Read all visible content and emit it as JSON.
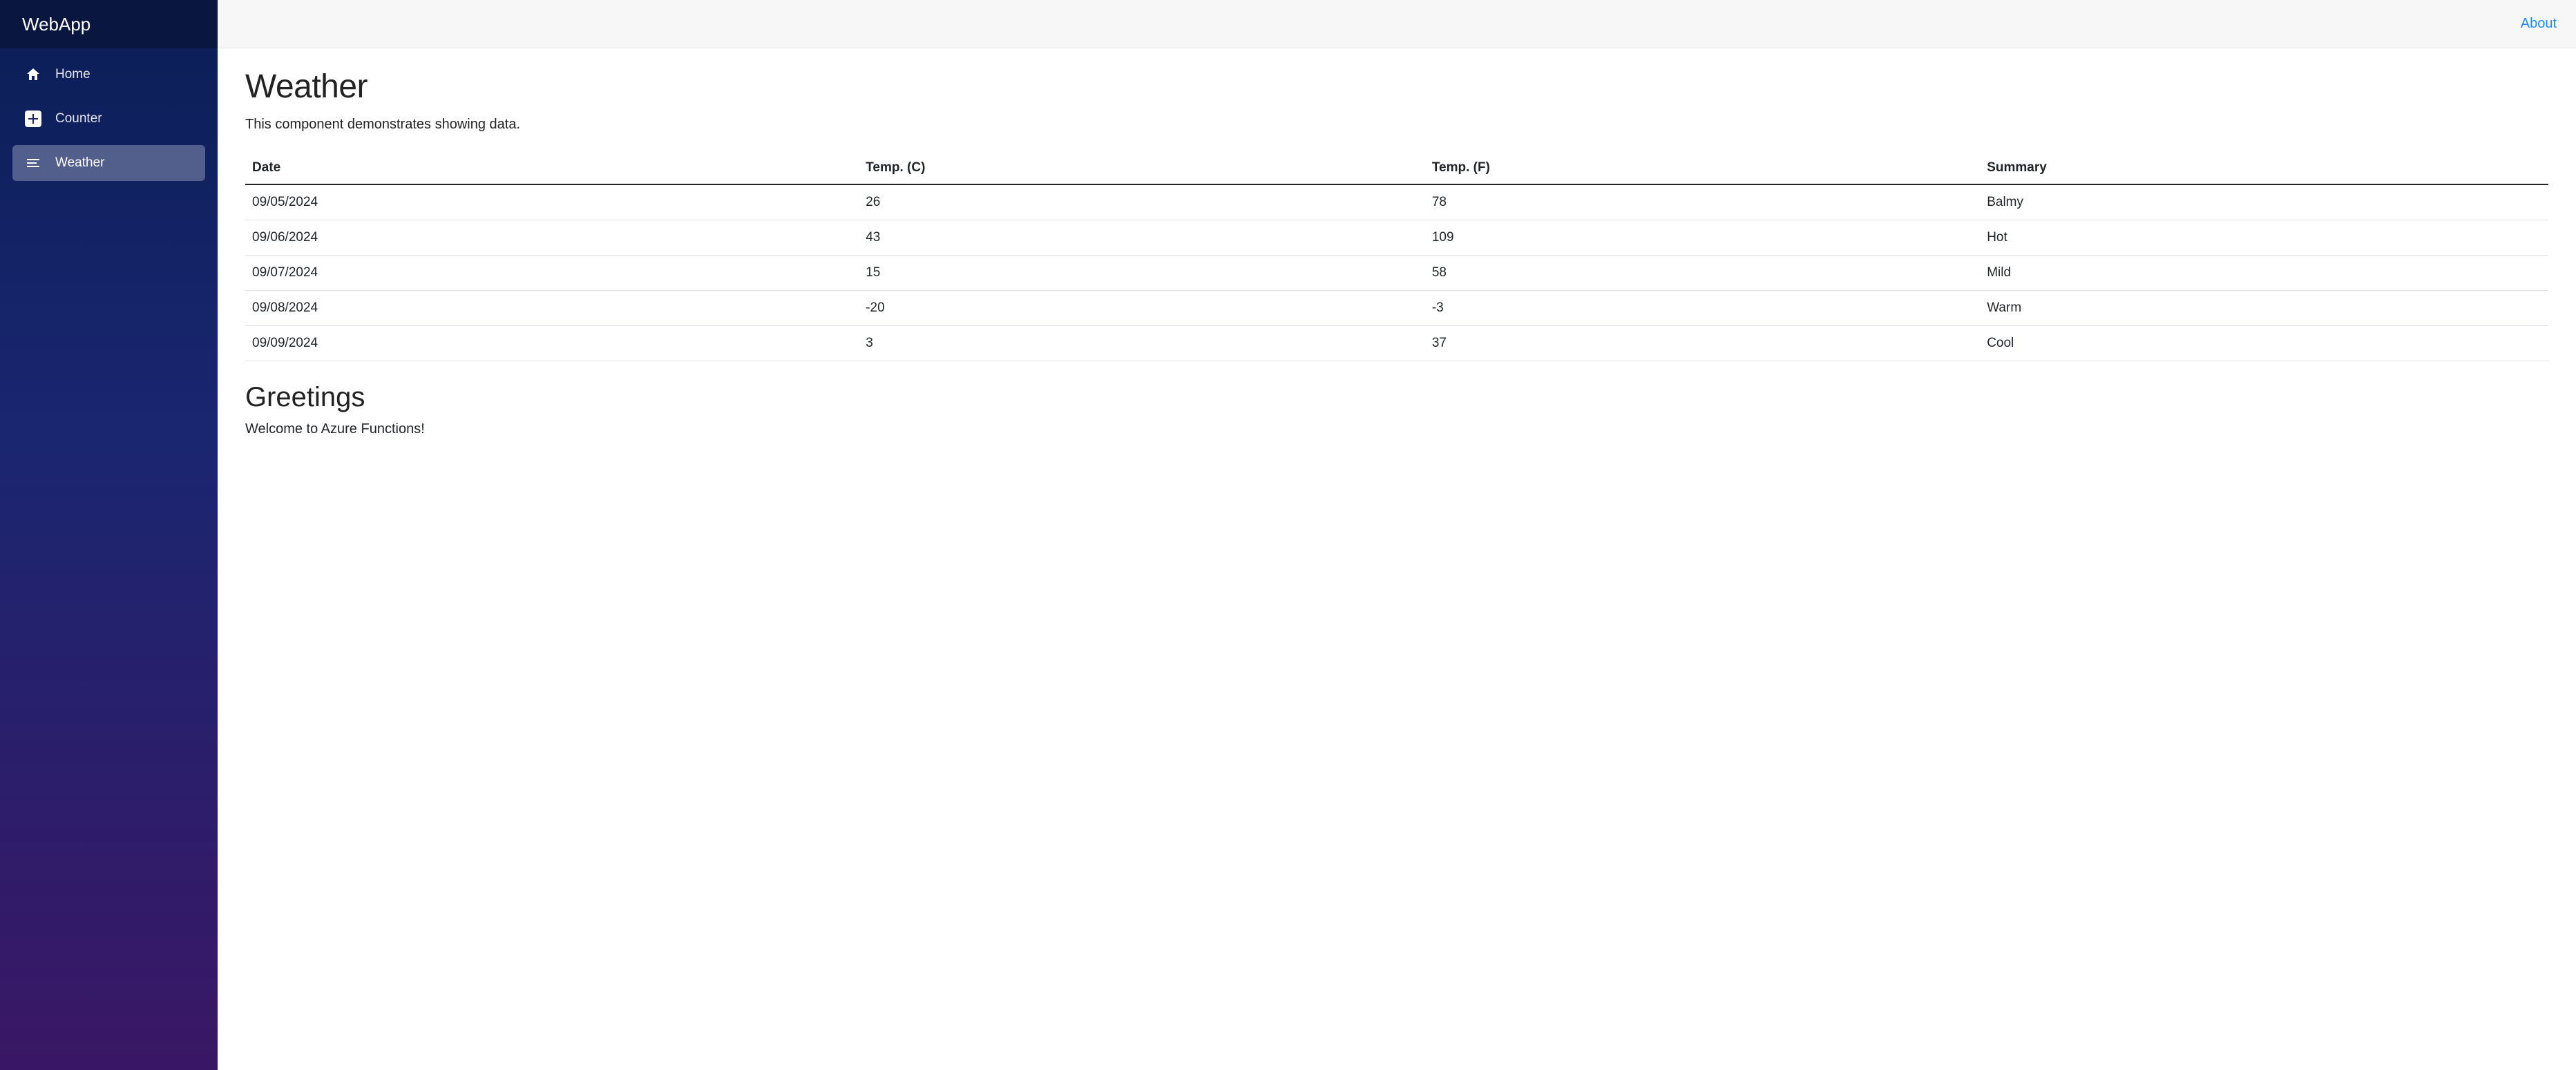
{
  "brand": "WebApp",
  "sidebar": {
    "items": [
      {
        "label": "Home",
        "icon": "home-icon",
        "active": false
      },
      {
        "label": "Counter",
        "icon": "plus-icon",
        "active": false
      },
      {
        "label": "Weather",
        "icon": "list-icon",
        "active": true
      }
    ]
  },
  "topbar": {
    "about_label": "About"
  },
  "page": {
    "title": "Weather",
    "subtitle": "This component demonstrates showing data."
  },
  "table": {
    "headers": [
      "Date",
      "Temp. (C)",
      "Temp. (F)",
      "Summary"
    ],
    "rows": [
      {
        "date": "09/05/2024",
        "tc": "26",
        "tf": "78",
        "summary": "Balmy"
      },
      {
        "date": "09/06/2024",
        "tc": "43",
        "tf": "109",
        "summary": "Hot"
      },
      {
        "date": "09/07/2024",
        "tc": "15",
        "tf": "58",
        "summary": "Mild"
      },
      {
        "date": "09/08/2024",
        "tc": "-20",
        "tf": "-3",
        "summary": "Warm"
      },
      {
        "date": "09/09/2024",
        "tc": "3",
        "tf": "37",
        "summary": "Cool"
      }
    ]
  },
  "greetings": {
    "title": "Greetings",
    "text": "Welcome to Azure Functions!"
  }
}
